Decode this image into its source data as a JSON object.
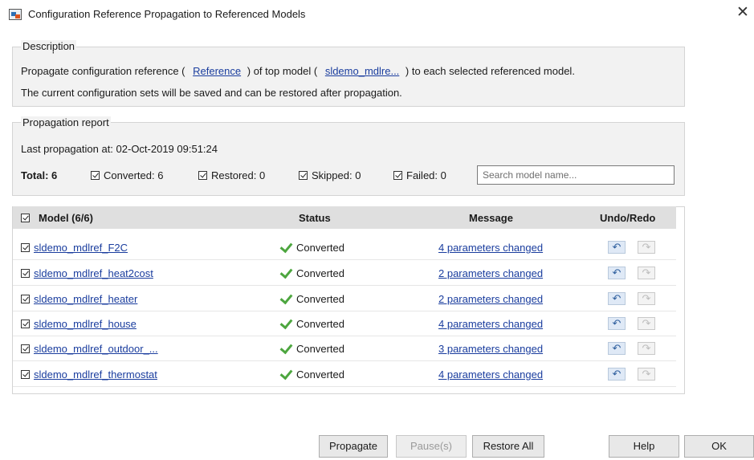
{
  "window": {
    "title": "Configuration Reference Propagation to Referenced Models",
    "close_glyph": "✕"
  },
  "description": {
    "group_title": "Description",
    "line1_part1": "Propagate configuration reference (",
    "reference_link": "Reference",
    "line1_part2": ") of top model (",
    "model_link": "sldemo_mdlre...",
    "line1_part3": ") to each selected referenced model.",
    "line2": "The current configuration sets will be saved and can be restored after propagation."
  },
  "report": {
    "group_title": "Propagation report",
    "last_propagation": "Last propagation at: 02-Oct-2019 09:51:24",
    "total_label": "Total: 6",
    "filters": [
      {
        "label": "Converted: 6",
        "checked": true
      },
      {
        "label": "Restored: 0",
        "checked": true
      },
      {
        "label": "Skipped: 0",
        "checked": true
      },
      {
        "label": "Failed: 0",
        "checked": true
      }
    ],
    "search_placeholder": "Search model name..."
  },
  "table": {
    "headers": {
      "model": "Model (6/6)",
      "status": "Status",
      "message": "Message",
      "undo_redo": "Undo/Redo"
    },
    "rows": [
      {
        "model": "sldemo_mdlref_F2C",
        "status": "Converted",
        "message": "4 parameters changed"
      },
      {
        "model": "sldemo_mdlref_heat2cost",
        "status": "Converted",
        "message": "2 parameters changed"
      },
      {
        "model": "sldemo_mdlref_heater",
        "status": "Converted",
        "message": "2 parameters changed"
      },
      {
        "model": "sldemo_mdlref_house",
        "status": "Converted",
        "message": "4 parameters changed"
      },
      {
        "model": "sldemo_mdlref_outdoor_...",
        "status": "Converted",
        "message": "3 parameters changed"
      },
      {
        "model": "sldemo_mdlref_thermostat",
        "status": "Converted",
        "message": "4 parameters changed"
      }
    ],
    "undo_glyph": "↶",
    "redo_glyph": "↷"
  },
  "buttons": {
    "propagate": "Propagate",
    "pause": "Pause(s)",
    "restore_all": "Restore All",
    "help": "Help",
    "ok": "OK"
  },
  "colors": {
    "link": "#1a3d9e",
    "status_check": "#4da63f",
    "group_bg": "#f2f2f2",
    "header_bg": "#dfdfdf"
  },
  "icons": {
    "app": "simulink-config-icon",
    "status": "green-check-icon",
    "undo": "undo-icon",
    "redo": "redo-icon"
  }
}
